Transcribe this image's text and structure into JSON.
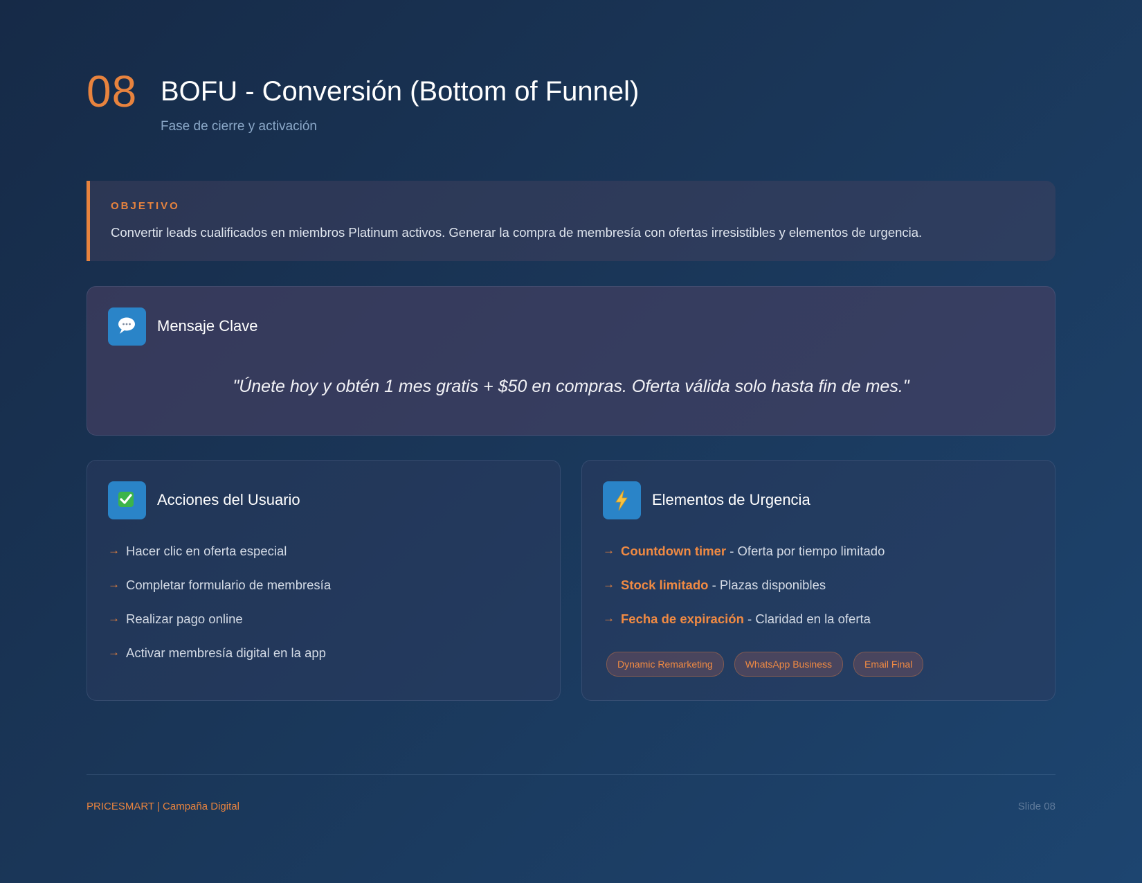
{
  "header": {
    "number": "08",
    "title": "BOFU - Conversión (Bottom of Funnel)",
    "subtitle": "Fase de cierre y activación"
  },
  "objective": {
    "label": "OBJETIVO",
    "text": "Convertir leads cualificados en miembros Platinum activos. Generar la compra de membresía con ofertas irresistibles y elementos de urgencia."
  },
  "message": {
    "icon": "speech-bubble-icon",
    "title": "Mensaje Clave",
    "quote": "\"Únete hoy y obtén 1 mes gratis + $50 en compras. Oferta válida solo hasta fin de mes.\""
  },
  "actions": {
    "icon": "check-mark-icon",
    "title": "Acciones del Usuario",
    "items": [
      "Hacer clic en oferta especial",
      "Completar formulario de membresía",
      "Realizar pago online",
      "Activar membresía digital en la app"
    ]
  },
  "urgency": {
    "icon": "lightning-icon",
    "title": "Elementos de Urgencia",
    "items": [
      {
        "highlight": "Countdown timer",
        "text": " - Oferta por tiempo limitado"
      },
      {
        "highlight": "Stock limitado",
        "text": " - Plazas disponibles"
      },
      {
        "highlight": "Fecha de expiración",
        "text": " - Claridad en la oferta"
      }
    ],
    "tags": [
      "Dynamic Remarketing",
      "WhatsApp Business",
      "Email Final"
    ]
  },
  "footer": {
    "brand": "PRICESMART | Campaña Digital",
    "slide": "Slide 08"
  },
  "colors": {
    "accent": "#e8833e",
    "icon_bg": "#2a84c8"
  },
  "list_arrow": "→"
}
